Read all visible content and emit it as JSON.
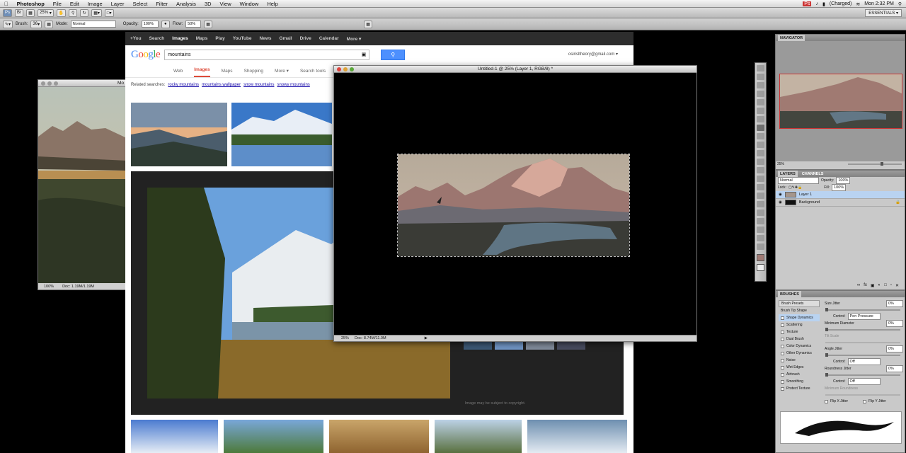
{
  "menubar": {
    "apple_icon": "apple-icon",
    "app_name": "Photoshop",
    "menus": [
      "File",
      "Edit",
      "Image",
      "Layer",
      "Select",
      "Filter",
      "Analysis",
      "3D",
      "View",
      "Window",
      "Help"
    ],
    "battery": "(Charged)",
    "clock": "Mon 2:32 PM"
  },
  "appbar": {
    "zoom": "25%",
    "workspace": "ESSENTIALS ▾"
  },
  "options": {
    "tool_label": "Brush:",
    "brush_size": "36",
    "mode_label": "Mode:",
    "mode_value": "Normal",
    "opacity_label": "Opacity:",
    "opacity_value": "100%",
    "flow_label": "Flow:",
    "flow_value": "50%"
  },
  "browser": {
    "gbar_items": [
      "+You",
      "Search",
      "Images",
      "Maps",
      "Play",
      "YouTube",
      "News",
      "Gmail",
      "Drive",
      "Calendar",
      "More ▾"
    ],
    "logo": "Google",
    "query": "mountains",
    "account": "osirisltheory@gmail.com ▾",
    "tabs": [
      "Web",
      "Images",
      "Maps",
      "Shopping",
      "More ▾",
      "Search tools"
    ],
    "related_label": "Related searches:",
    "related": [
      "rocky mountains",
      "mountains wallpaper",
      "snow mountains",
      "snowy mountains"
    ],
    "disclaimer": "Image may be subject to copyright."
  },
  "document": {
    "title": "Untitled-1 @ 25% (Layer 1, RGB/8) *",
    "zoom": "25%",
    "doc_size": "Doc: 8.74M/11.0M"
  },
  "reference": {
    "title": "Mo",
    "zoom": "100%",
    "doc_size": "Doc: 1.19M/1.19M"
  },
  "navigator": {
    "tab": "NAVIGATOR",
    "zoom": "25%"
  },
  "layers": {
    "tabs": [
      "LAYERS",
      "CHANNELS"
    ],
    "blend": "Normal",
    "opacity_label": "Opacity:",
    "opacity": "100%",
    "lock_label": "Lock:",
    "fill_label": "Fill:",
    "fill": "100%",
    "items": [
      {
        "name": "Layer 1"
      },
      {
        "name": "Background"
      }
    ]
  },
  "brushes": {
    "tab": "BRUSHES",
    "left_items": [
      "Brush Presets",
      "Brush Tip Shape",
      "Shape Dynamics",
      "Scattering",
      "Texture",
      "Dual Brush",
      "Color Dynamics",
      "Other Dynamics",
      "Noise",
      "Wet Edges",
      "Airbrush",
      "Smoothing",
      "Protect Texture"
    ],
    "size_jitter": "Size Jitter",
    "size_jitter_val": "0%",
    "control": "Control:",
    "control_val1": "Pen Pressure",
    "min_diameter": "Minimum Diameter",
    "min_diameter_val": "0%",
    "tilt_scale": "Tilt Scale",
    "angle_jitter": "Angle Jitter",
    "angle_jitter_val": "0%",
    "control_val2": "Off",
    "roundness_jitter": "Roundness Jitter",
    "roundness_jitter_val": "0%",
    "control_val3": "Off",
    "min_roundness": "Minimum Roundness",
    "flip_x": "Flip X Jitter",
    "flip_y": "Flip Y Jitter"
  },
  "colors": {
    "accent": "#4d90fe",
    "selection": "#b9d3f1",
    "tab_active": "#dd4b39"
  }
}
